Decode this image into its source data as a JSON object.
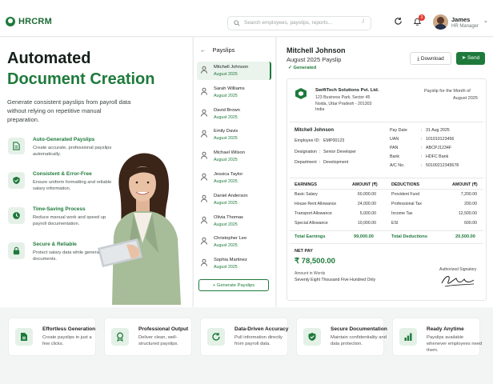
{
  "header": {
    "logo": "HRCRM",
    "search_placeholder": "Search employees, payslips, reports...",
    "search_shortcut": "/",
    "notification_count": "3",
    "user_name": "James",
    "user_role": "HR Manager"
  },
  "hero": {
    "title_line1": "Automated",
    "title_line2": "Document Creation",
    "lead": "Generate consistent payslips from payroll data without relying on repetitive manual preparation.",
    "features": [
      {
        "title": "Auto-Generated Payslips",
        "desc": "Create accurate, professional payslips automatically.",
        "icon": "document-icon"
      },
      {
        "title": "Consistent & Error-Free",
        "desc": "Ensure uniform formatting and reliable salary information.",
        "icon": "shield-check-icon"
      },
      {
        "title": "Time-Saving Process",
        "desc": "Reduce manual work and speed up payroll documentation.",
        "icon": "clock-icon"
      },
      {
        "title": "Secure & Reliable",
        "desc": "Protect salary data while generating documents.",
        "icon": "lock-icon"
      }
    ]
  },
  "payslips": {
    "heading": "Payslips",
    "back_icon": "arrow-left-icon",
    "items": [
      {
        "name": "Mitchell Johnson",
        "period": "August 2025"
      },
      {
        "name": "Sarah Williams",
        "period": "August 2025"
      },
      {
        "name": "David Brown",
        "period": "August 2025"
      },
      {
        "name": "Emily Davis",
        "period": "August 2025"
      },
      {
        "name": "Michael Wilson",
        "period": "August 2025"
      },
      {
        "name": "Jessica Taylor",
        "period": "August 2025"
      },
      {
        "name": "Daniel Anderson",
        "period": "August 2025"
      },
      {
        "name": "Olivia Thomas",
        "period": "August 2025"
      },
      {
        "name": "Christopher Lee",
        "period": "August 2025"
      },
      {
        "name": "Sophia Martinez",
        "period": "August 2025"
      }
    ],
    "generate_label": "+ Generate Payslips"
  },
  "detail": {
    "name": "Mitchell Johnson",
    "subtitle": "August 2025 Payslip",
    "status": "Generated",
    "download_label": "Download",
    "send_label": "Send",
    "company_name": "SwiftTech Solutions Pvt. Ltd.",
    "company_addr": "123 Business Park, Sector 45 Noida, Uttar Pradesh - 201303 India",
    "payslip_for": "Payslip for the Month of",
    "payslip_month": "August 2025",
    "employee_name": "Mitchell Johnson",
    "left_info": [
      {
        "k": "Employee ID",
        "v": "EMP00123"
      },
      {
        "k": "Designation",
        "v": "Senior Developer"
      },
      {
        "k": "Department",
        "v": "Development"
      }
    ],
    "right_info": [
      {
        "k": "Pay Date",
        "v": "31 Aug 2025"
      },
      {
        "k": "UAN",
        "v": "101010123456"
      },
      {
        "k": "PAN",
        "v": "ABCPJ1234F"
      },
      {
        "k": "Bank",
        "v": "HDFC Bank"
      },
      {
        "k": "A/C No.",
        "v": "50100212345678"
      }
    ],
    "earnings_header": "EARNINGS",
    "deductions_header": "DEDUCTIONS",
    "amount_header": "AMOUNT (₹)",
    "earnings": [
      {
        "k": "Basic Salary",
        "v": "60,000.00"
      },
      {
        "k": "House Rent Allowance",
        "v": "24,000.00"
      },
      {
        "k": "Transport Allowance",
        "v": "5,000.00"
      },
      {
        "k": "Special Allowance",
        "v": "10,000.00"
      }
    ],
    "deductions": [
      {
        "k": "Provident Fund",
        "v": "7,200.00"
      },
      {
        "k": "Professional Tax",
        "v": "200.00"
      },
      {
        "k": "Income Tax",
        "v": "12,500.00"
      },
      {
        "k": "ESI",
        "v": "600.00"
      }
    ],
    "total_earnings_label": "Total Earnings",
    "total_earnings": "99,000.00",
    "total_deductions_label": "Total Deductions",
    "total_deductions": "20,500.00",
    "net_pay_label": "NET PAY",
    "net_pay": "₹ 78,500.00",
    "amount_words_label": "Amount in Words",
    "amount_words": "Seventy Eight Thousand Five Hundred Only",
    "signatory": "Authorized Signatory"
  },
  "benefits": [
    {
      "title": "Effortless Generation",
      "desc": "Create payslips in just a few clicks.",
      "icon": "document-icon"
    },
    {
      "title": "Professional Output",
      "desc": "Deliver clean, well-structured payslips.",
      "icon": "award-icon"
    },
    {
      "title": "Data-Driven Accuracy",
      "desc": "Pull information directly from payroll data.",
      "icon": "refresh-icon"
    },
    {
      "title": "Secure Documentation",
      "desc": "Maintain confidentiality and data protection.",
      "icon": "shield-check-icon"
    },
    {
      "title": "Ready Anytime",
      "desc": "Payslips available whenever employees need them.",
      "icon": "bar-chart-icon"
    }
  ],
  "colors": {
    "accent": "#1e7a3b",
    "accent_light": "#e5f1e8",
    "badge": "#e23b30"
  }
}
